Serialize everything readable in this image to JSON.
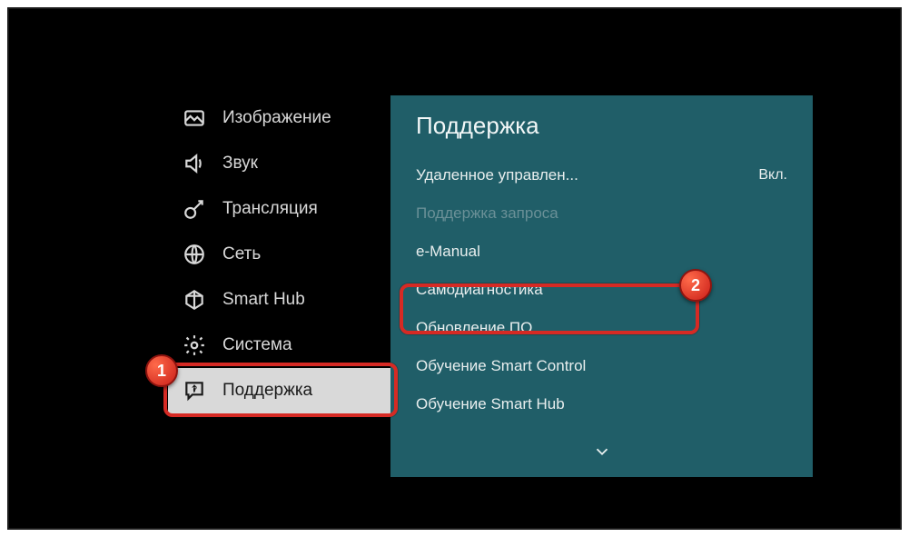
{
  "sidebar": {
    "items": [
      {
        "label": "Изображение",
        "icon": "picture-icon"
      },
      {
        "label": "Звук",
        "icon": "sound-icon"
      },
      {
        "label": "Трансляция",
        "icon": "broadcast-icon"
      },
      {
        "label": "Сеть",
        "icon": "network-icon"
      },
      {
        "label": "Smart Hub",
        "icon": "smarthub-icon"
      },
      {
        "label": "Система",
        "icon": "system-icon"
      },
      {
        "label": "Поддержка",
        "icon": "support-icon",
        "selected": true
      }
    ]
  },
  "panel": {
    "title": "Поддержка",
    "items": [
      {
        "label": "Удаленное управлен...",
        "value": "Вкл.",
        "dim": false
      },
      {
        "label": "Поддержка запроса",
        "dim": true
      },
      {
        "label": "e-Manual",
        "dim": false
      },
      {
        "label": "Самодиагностика",
        "dim": false
      },
      {
        "label": "Обновление ПО",
        "dim": false,
        "highlighted": true
      },
      {
        "label": "Обучение Smart Control",
        "dim": false
      },
      {
        "label": "Обучение Smart Hub",
        "dim": false
      }
    ]
  },
  "annotations": {
    "badge1": "1",
    "badge2": "2"
  },
  "colors": {
    "panel_bg": "#205e68",
    "highlight": "#d62a24",
    "sidebar_selected_bg": "#d9d9d9"
  }
}
